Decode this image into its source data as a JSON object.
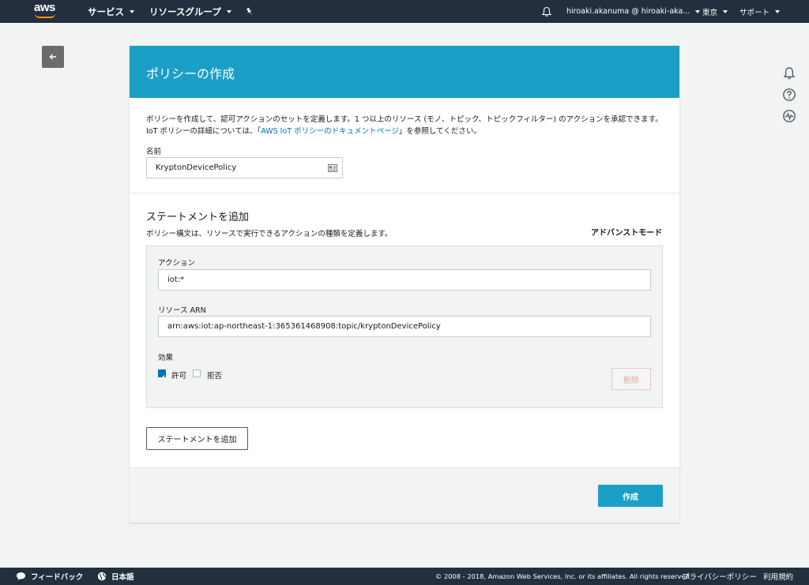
{
  "nav": {
    "services": "サービス",
    "resource_groups": "リソースグループ",
    "account": "hiroaki.akanuma @ hiroaki-aka...",
    "region": "東京",
    "support": "サポート"
  },
  "page": {
    "title": "ポリシーの作成",
    "description_pre": "ポリシーを作成して、認可アクションのセットを定義します。1 つ以上のリソース (モノ、トピック、トピックフィルター) のアクションを承認できます。IoT ポリシーの詳細については、「",
    "description_link": "AWS IoT ポリシーのドキュメントページ",
    "description_post": "」を参照してください。",
    "name_label": "名前",
    "name_value": "KryptonDevicePolicy",
    "statement_title": "ステートメントを追加",
    "statement_sub": "ポリシー構文は、リソースで実行できるアクションの種類を定義します。",
    "advanced_mode": "アドバンストモード",
    "action_label": "アクション",
    "action_value": "iot:*",
    "resource_label": "リソース ARN",
    "resource_value": "arn:aws:iot:ap-northeast-1:365361468908:topic/kryptonDevicePolicy",
    "effect_label": "効果",
    "allow_label": "許可",
    "allow_checked": true,
    "deny_label": "拒否",
    "deny_checked": false,
    "delete_button": "削除",
    "add_statement_button": "ステートメントを追加",
    "create_button": "作成"
  },
  "footer": {
    "feedback": "フィードバック",
    "language": "日本語",
    "copyright": "© 2008 - 2018, Amazon Web Services, Inc. or its affiliates. All rights reserved.",
    "privacy": "プライバシーポリシー",
    "terms": "利用規約"
  },
  "colors": {
    "nav_bg": "#232f3e",
    "header_bg": "#1b9fc7",
    "primary": "#1b9fc7",
    "logo_accent": "#ff9900"
  }
}
